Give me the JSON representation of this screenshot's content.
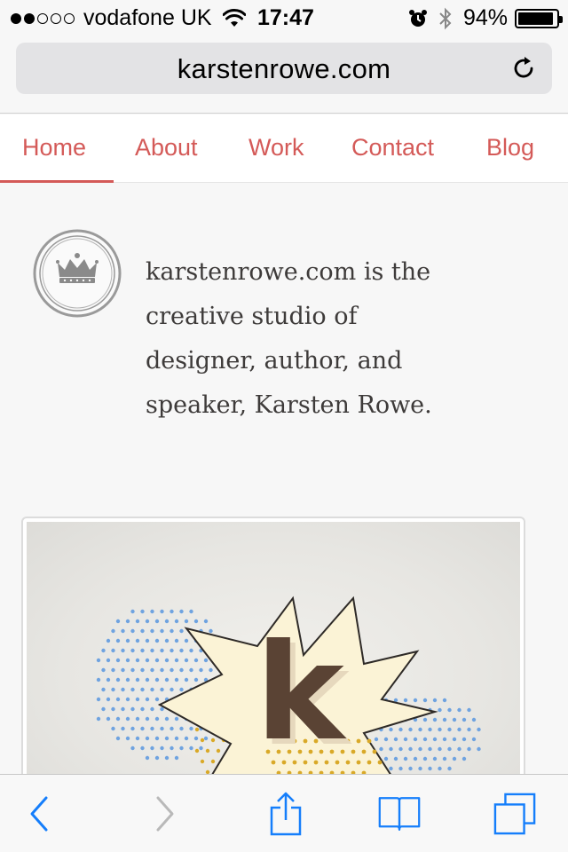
{
  "status_bar": {
    "carrier": "vodafone UK",
    "signal_bars_filled": 2,
    "signal_bars_total": 5,
    "time": "17:47",
    "battery_percent_label": "94%",
    "battery_level": 0.94
  },
  "browser": {
    "address": "karstenrowe.com",
    "reload_icon": "reload-icon"
  },
  "nav": {
    "items": [
      {
        "label": "Home",
        "active": true
      },
      {
        "label": "About"
      },
      {
        "label": "Work"
      },
      {
        "label": "Contact"
      },
      {
        "label": "Blog"
      }
    ],
    "accent_color": "#d45a58"
  },
  "intro": {
    "logo_icon": "crown-badge-icon",
    "lines": [
      "karstenrowe.com is the",
      "creative studio of",
      "designer, author, and",
      "speaker, Karsten Rowe."
    ]
  },
  "hero": {
    "letter": "k"
  },
  "toolbar": {
    "icons": [
      "back-arrow-icon",
      "forward-arrow-icon",
      "share-icon",
      "bookmarks-icon",
      "tabs-icon"
    ],
    "accent_color": "#157efb"
  }
}
